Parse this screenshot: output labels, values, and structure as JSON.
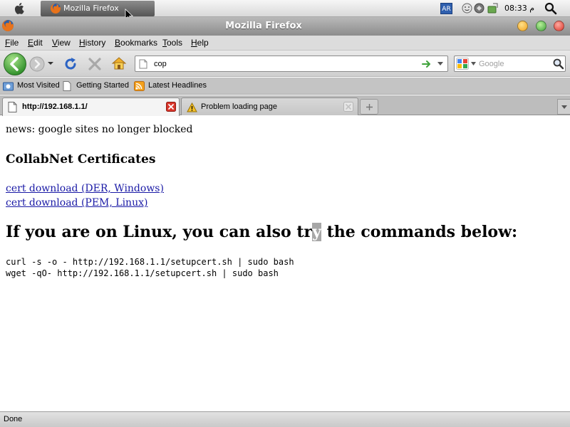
{
  "system_panel": {
    "taskbar_item": "Mozilla Firefox",
    "keyboard_layout": "AR",
    "clock": "08:33 م"
  },
  "window": {
    "title": "Mozilla Firefox"
  },
  "menu": [
    "File",
    "Edit",
    "View",
    "History",
    "Bookmarks",
    "Tools",
    "Help"
  ],
  "navigation": {
    "url_value": "cop",
    "search_engine": "Google",
    "search_placeholder": "Google"
  },
  "bookmarks": [
    "Most Visited",
    "Getting Started",
    "Latest Headlines"
  ],
  "tabs": [
    {
      "label": "http://192.168.1.1/",
      "active": true
    },
    {
      "label": "Problem loading page",
      "active": false
    }
  ],
  "page": {
    "news": "news: google sites no longer blocked",
    "cert_heading": "CollabNet Certificates",
    "links": [
      "cert download (DER, Windows)",
      "cert download (PEM, Linux)"
    ],
    "linux_heading_before": "If you are on Linux, you can also tr",
    "linux_heading_selected": "y",
    "linux_heading_after": " the commands below:",
    "commands": [
      "curl -s -o - http://192.168.1.1/setupcert.sh | sudo bash",
      "wget -qO- http://192.168.1.1/setupcert.sh | sudo bash"
    ]
  },
  "status": {
    "text": "Done"
  },
  "colors": {
    "link": "#1a1aa6",
    "selection": "#a7a7a7",
    "accent_green": "#3fa33b"
  }
}
